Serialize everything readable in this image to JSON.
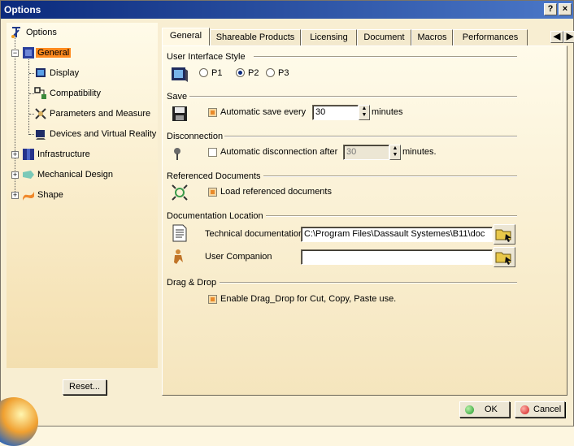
{
  "window": {
    "title": "Options",
    "help_label": "?",
    "close_label": "×"
  },
  "tree": {
    "items": [
      {
        "label": "Options"
      },
      {
        "label": "General"
      },
      {
        "label": "Display"
      },
      {
        "label": "Compatibility"
      },
      {
        "label": "Parameters and Measure"
      },
      {
        "label": "Devices and Virtual Reality"
      },
      {
        "label": "Infrastructure"
      },
      {
        "label": "Mechanical Design"
      },
      {
        "label": "Shape"
      }
    ]
  },
  "reset_label": "Reset...",
  "tabs": [
    "General",
    "Shareable Products",
    "Licensing",
    "Document",
    "Macros",
    "Performances"
  ],
  "sections": {
    "ui_style": {
      "title": "User Interface Style",
      "options": [
        "P1",
        "P2",
        "P3"
      ],
      "selected": "P2"
    },
    "save": {
      "title": "Save",
      "checkbox_label": "Automatic save every",
      "checked": true,
      "value": "30",
      "unit": "minutes"
    },
    "disconnection": {
      "title": "Disconnection",
      "checkbox_label": "Automatic disconnection after",
      "checked": false,
      "value": "30",
      "unit": "minutes."
    },
    "referenced": {
      "title": "Referenced Documents",
      "checkbox_label": "Load referenced documents",
      "checked": true
    },
    "doc_location": {
      "title": "Documentation Location",
      "tech_label": "Technical documentation",
      "tech_value": "C:\\Program Files\\Dassault Systemes\\B11\\doc",
      "companion_label": "User Companion",
      "companion_value": ""
    },
    "dragdrop": {
      "title": "Drag & Drop",
      "checkbox_label": "Enable Drag_Drop for Cut, Copy, Paste use.",
      "checked": true
    }
  },
  "buttons": {
    "ok": "OK",
    "cancel": "Cancel"
  },
  "colors": {
    "titlebar": "#0b2a7c",
    "selection": "#ff8a1e",
    "checkbox_fill": "#e98a2a"
  }
}
